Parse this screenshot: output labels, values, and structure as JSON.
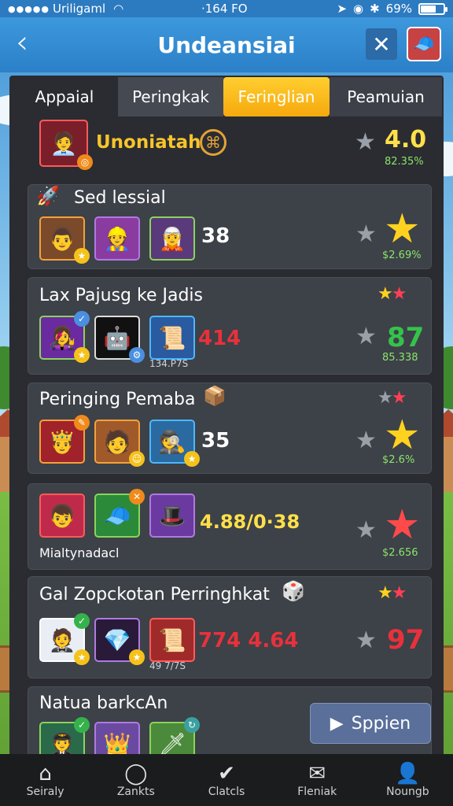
{
  "status": {
    "carrier": "Uriligaml",
    "time": "·164 FO",
    "battery": "69%",
    "battery_level": 0.69
  },
  "header": {
    "title": "Undeansiai",
    "back_icon": "chevron-left-icon",
    "close_icon": "close-icon"
  },
  "tabs": [
    {
      "label": "Appaial"
    },
    {
      "label": "Peringkak"
    },
    {
      "label": "Feringlian",
      "active": true
    },
    {
      "label": "Peamuian"
    }
  ],
  "top_player": {
    "name": "Unoniatah",
    "score": "4.0",
    "pct": "82.35%"
  },
  "cards": [
    {
      "title": "Sed lessial",
      "mid": "38",
      "pct": "$2.69%"
    },
    {
      "title": "Lax Pajusg ke Jadis",
      "mid": "414",
      "sub": "134.P7S",
      "score": "87",
      "pct": "85.338"
    },
    {
      "title": "Peringing Pemaba",
      "mid": "35",
      "pct": "$2.6%"
    },
    {
      "title": "Mialtynadacl",
      "mid": "4.88/0·38",
      "pct": "$2.656"
    },
    {
      "title": "Gal Zopckotan Perringhkat",
      "mid": "774 4.64",
      "sub": "49 7/7S",
      "score": "97"
    },
    {
      "title": "Natua barkcAn"
    }
  ],
  "spin_button": {
    "label": "Sppien"
  },
  "nav": [
    {
      "label": "Seiraly",
      "icon": "home-icon"
    },
    {
      "label": "Zankts",
      "icon": "search-icon"
    },
    {
      "label": "Clatcls",
      "icon": "check-icon"
    },
    {
      "label": "Fleniak",
      "icon": "mail-icon"
    },
    {
      "label": "Noungb",
      "icon": "profile-icon"
    }
  ],
  "colors": {
    "accent": "#f6b319",
    "header": "#2f88d0",
    "panel": "#2a2c31",
    "card": "#3d4148",
    "red_text": "#e8313b",
    "green_text": "#35c24b",
    "yellow_text": "#ffe04a"
  }
}
